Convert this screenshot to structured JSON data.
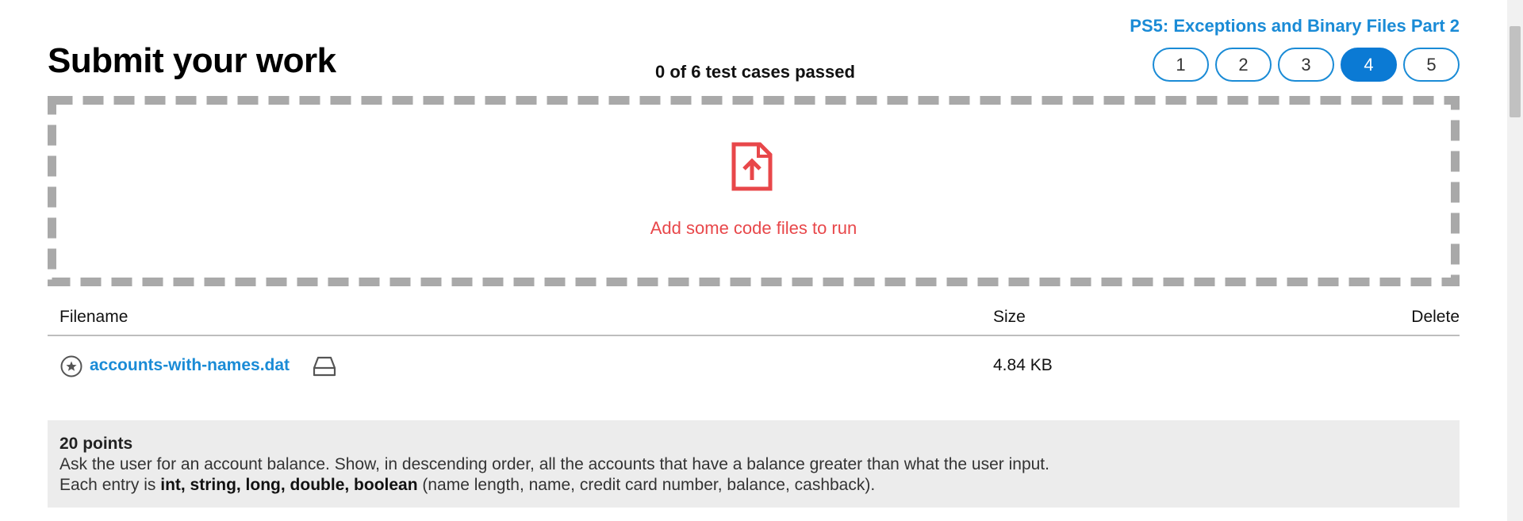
{
  "header": {
    "assignment_title": "PS5: Exceptions and Binary Files Part 2",
    "page_title": "Submit your work",
    "test_status": "0 of 6 test cases passed"
  },
  "step_nav": {
    "steps": [
      "1",
      "2",
      "3",
      "4",
      "5"
    ],
    "active_step": "4",
    "accent_color": "#1a8bd6",
    "active_color": "#0b7ad4"
  },
  "dropzone": {
    "icon": "file-upload-icon",
    "text": "Add some code files to run",
    "text_color": "#e8474a"
  },
  "files_table": {
    "columns": {
      "filename": "Filename",
      "size": "Size",
      "delete": "Delete"
    },
    "rows": [
      {
        "star_icon": "star-circle-icon",
        "filename": "accounts-with-names.dat",
        "drive_icon": "drive-icon",
        "size": "4.84 KB"
      }
    ]
  },
  "description": {
    "points": "20 points",
    "line1": "Ask the user for an account balance. Show, in descending order, all the accounts that have a balance greater than what the user input.",
    "line2_prefix": "Each entry is ",
    "line2_bold": "int, string, long, double, boolean",
    "line2_suffix": " (name length, name, credit card number, balance, cashback)."
  }
}
